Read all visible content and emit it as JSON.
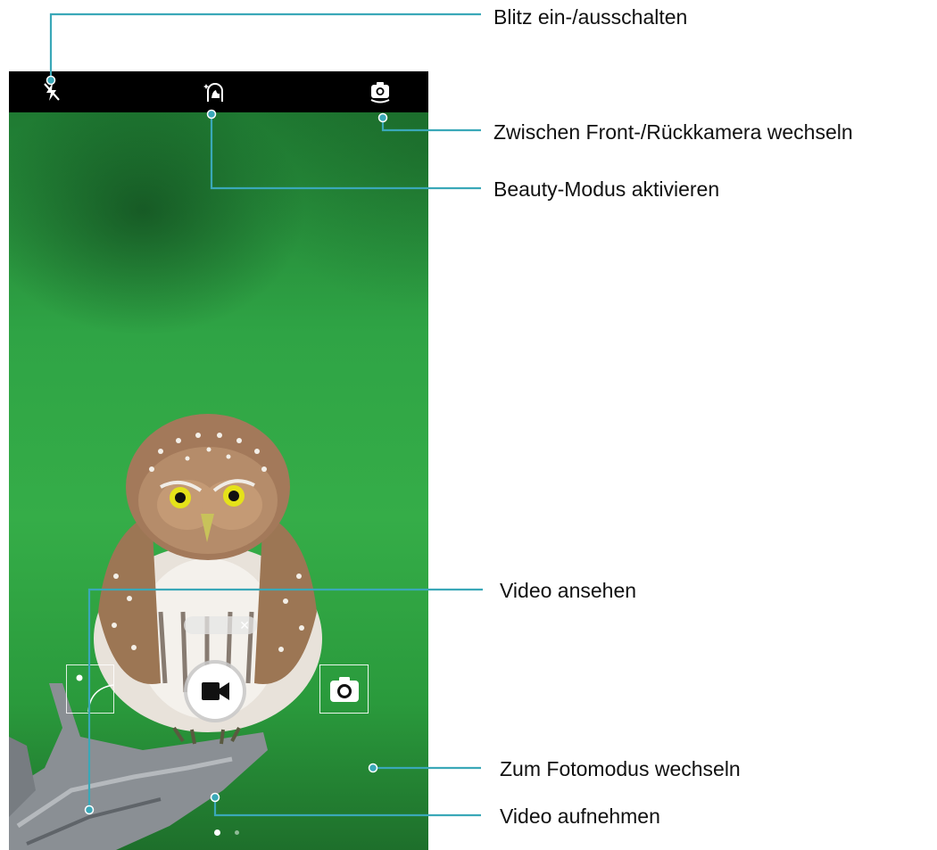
{
  "annotations": {
    "flash": "Blitz ein-/ausschalten",
    "switch_camera": "Zwischen Front-/Rückkamera wechseln",
    "beauty": "Beauty-Modus aktivieren",
    "view_video": "Video ansehen",
    "photo_mode": "Zum Fotomodus wechseln",
    "record": "Video aufnehmen"
  },
  "camera": {
    "mode": "video",
    "page_indicator": {
      "count": 2,
      "active": 1
    }
  },
  "icons": {
    "flash": "flash-off-icon",
    "beauty": "beauty-icon",
    "switch": "switch-camera-icon",
    "record": "video-camera-icon",
    "photo": "camera-icon",
    "close": "close-icon"
  },
  "colors": {
    "callout_line": "#3aa8b8",
    "topbar": "#000000",
    "viewfinder": "#2fa544"
  }
}
